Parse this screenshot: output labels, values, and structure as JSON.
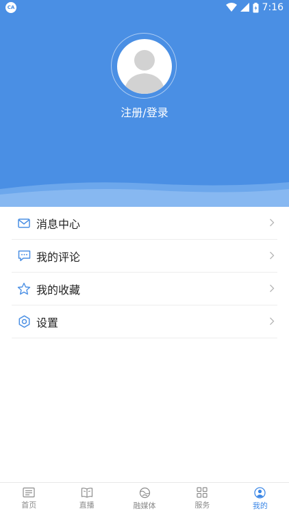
{
  "status_bar": {
    "time": "7:16",
    "app_badge": "CA"
  },
  "profile": {
    "login_text": "注册/登录"
  },
  "menu": [
    {
      "label": "消息中心",
      "icon": "mail-icon"
    },
    {
      "label": "我的评论",
      "icon": "comment-icon"
    },
    {
      "label": "我的收藏",
      "icon": "star-icon"
    },
    {
      "label": "设置",
      "icon": "gear-icon"
    }
  ],
  "tabs": [
    {
      "label": "首页",
      "icon": "news-icon",
      "active": false
    },
    {
      "label": "直播",
      "icon": "book-icon",
      "active": false
    },
    {
      "label": "融媒体",
      "icon": "globe-icon",
      "active": false
    },
    {
      "label": "服务",
      "icon": "grid-icon",
      "active": false
    },
    {
      "label": "我的",
      "icon": "user-icon",
      "active": true
    }
  ],
  "colors": {
    "header": "#4a8fe4",
    "accent": "#3a86e6",
    "icon_blue": "#4a8fe4",
    "tab_gray": "#8a8a8a"
  }
}
